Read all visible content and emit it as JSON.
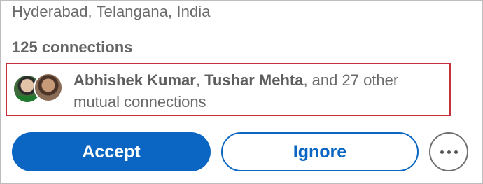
{
  "profile": {
    "location": "Hyderabad, Telangana, India",
    "connections": "125 connections"
  },
  "mutual": {
    "name_1": "Abhishek Kumar",
    "separator": ", ",
    "name_2": "Tushar Mehta",
    "rest": ", and 27 other mutual connections"
  },
  "actions": {
    "accept_label": "Accept",
    "ignore_label": "Ignore",
    "more_icon": "more-horizontal-icon"
  },
  "colors": {
    "primary": "#0a66c2",
    "highlight_border": "#c5303a"
  }
}
